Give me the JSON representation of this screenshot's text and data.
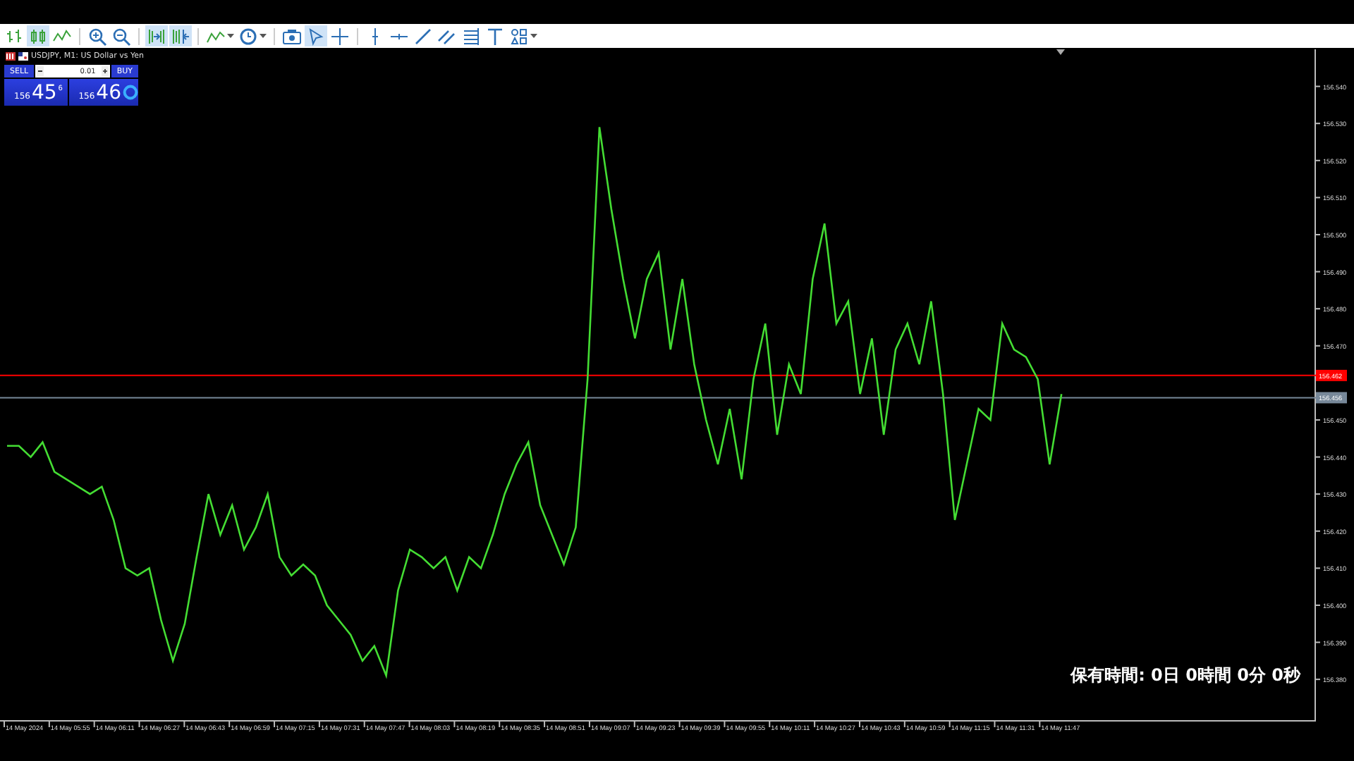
{
  "toolbar": {
    "items": [
      {
        "kind": "bars",
        "selected": false
      },
      {
        "kind": "candles",
        "selected": true
      },
      {
        "kind": "line",
        "selected": false
      },
      {
        "kind": "separator"
      },
      {
        "kind": "zoom-in",
        "selected": false
      },
      {
        "kind": "zoom-out",
        "selected": false
      },
      {
        "kind": "separator"
      },
      {
        "kind": "autoscroll",
        "selected": true
      },
      {
        "kind": "chart-shift",
        "selected": true
      },
      {
        "kind": "separator"
      },
      {
        "kind": "indicators",
        "selected": false
      },
      {
        "kind": "clock",
        "selected": false
      },
      {
        "kind": "separator"
      },
      {
        "kind": "screenshot",
        "selected": false
      },
      {
        "kind": "cursor",
        "selected": true
      },
      {
        "kind": "crosshair",
        "selected": false
      },
      {
        "kind": "separator"
      },
      {
        "kind": "vline",
        "selected": false
      },
      {
        "kind": "hline",
        "selected": false
      },
      {
        "kind": "trendline",
        "selected": false
      },
      {
        "kind": "channel",
        "selected": false
      },
      {
        "kind": "fibo",
        "selected": false
      },
      {
        "kind": "text",
        "selected": false
      },
      {
        "kind": "shapes",
        "selected": false
      }
    ]
  },
  "chart_window": {
    "title": "USDJPY, M1:  US Dollar vs Yen",
    "trade_panel": {
      "sell": {
        "label": "SELL",
        "price_small": "156",
        "price_big": "45",
        "price_sup": "6"
      },
      "lot": "0.01",
      "buy": {
        "label": "BUY",
        "price_small": "156",
        "price_big": "46"
      }
    },
    "holding_time": "保有時間: 0日 0時間 0分 0秒",
    "time_axis": [
      "14 May 2024",
      "14 May 05:55",
      "14 May 06:11",
      "14 May 06:27",
      "14 May 06:43",
      "14 May 06:59",
      "14 May 07:15",
      "14 May 07:31",
      "14 May 07:47",
      "14 May 08:03",
      "14 May 08:19",
      "14 May 08:35",
      "14 May 08:51",
      "14 May 09:07",
      "14 May 09:23",
      "14 May 09:39",
      "14 May 09:55",
      "14 May 10:11",
      "14 May 10:27",
      "14 May 10:43",
      "14 May 10:59",
      "14 May 11:15",
      "14 May 11:31",
      "14 May 11:47"
    ],
    "chart_data": {
      "type": "line",
      "ylim": [
        156.369,
        156.55
      ],
      "yticks": [
        {
          "value": 156.54,
          "label": "156.540"
        },
        {
          "value": 156.53,
          "label": "156.530"
        },
        {
          "value": 156.52,
          "label": "156.520"
        },
        {
          "value": 156.51,
          "label": "156.510"
        },
        {
          "value": 156.5,
          "label": "156.500"
        },
        {
          "value": 156.49,
          "label": "156.490"
        },
        {
          "value": 156.48,
          "label": "156.480"
        },
        {
          "value": 156.47,
          "label": "156.470"
        },
        {
          "value": 156.45,
          "label": "156.450"
        },
        {
          "value": 156.44,
          "label": "156.440"
        },
        {
          "value": 156.43,
          "label": "156.430"
        },
        {
          "value": 156.42,
          "label": "156.420"
        },
        {
          "value": 156.41,
          "label": "156.410"
        },
        {
          "value": 156.4,
          "label": "156.400"
        },
        {
          "value": 156.39,
          "label": "156.390"
        },
        {
          "value": 156.38,
          "label": "156.380"
        }
      ],
      "series": [
        {
          "color": "#44dd33",
          "values": [
            156.443,
            156.443,
            156.44,
            156.444,
            156.436,
            156.434,
            156.432,
            156.43,
            156.432,
            156.423,
            156.41,
            156.408,
            156.41,
            156.396,
            156.385,
            156.395,
            156.413,
            156.43,
            156.419,
            156.427,
            156.415,
            156.421,
            156.43,
            156.413,
            156.408,
            156.411,
            156.408,
            156.4,
            156.396,
            156.392,
            156.385,
            156.389,
            156.381,
            156.404,
            156.415,
            156.413,
            156.41,
            156.413,
            156.404,
            156.413,
            156.41,
            156.419,
            156.43,
            156.438,
            156.444,
            156.427,
            156.419,
            156.411,
            156.421,
            156.461,
            156.529,
            156.507,
            156.488,
            156.472,
            156.488,
            156.495,
            156.469,
            156.488,
            156.465,
            156.45,
            156.438,
            156.453,
            156.434,
            156.461,
            156.476,
            156.446,
            156.465,
            156.457,
            156.488,
            156.503,
            156.476,
            156.482,
            156.457,
            156.472,
            156.446,
            156.469,
            156.476,
            156.465,
            156.482,
            156.457,
            156.423,
            156.438,
            156.453,
            156.45,
            156.476,
            156.469,
            156.467,
            156.461,
            156.438,
            156.457
          ]
        }
      ],
      "ref_lines": [
        {
          "axis": "y",
          "value": 156.462,
          "label": "156.462",
          "color": "#ff0000"
        },
        {
          "axis": "y",
          "value": 156.456,
          "label": "156.456",
          "color": "#778899"
        }
      ]
    }
  }
}
